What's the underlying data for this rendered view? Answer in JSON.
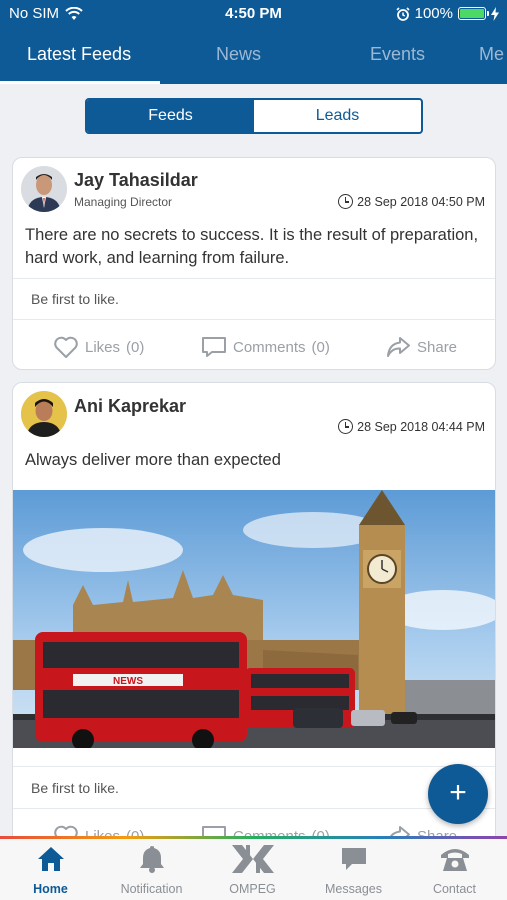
{
  "status_bar": {
    "carrier": "No SIM",
    "time": "4:50 PM",
    "battery": "100%",
    "battery_level": 1.0
  },
  "tabs": [
    {
      "label": "Latest Feeds",
      "active": true
    },
    {
      "label": "News",
      "active": false
    },
    {
      "label": "Events",
      "active": false
    },
    {
      "label": "Me",
      "active": false
    }
  ],
  "segments": [
    {
      "label": "Feeds",
      "active": true
    },
    {
      "label": "Leads",
      "active": false
    }
  ],
  "posts": [
    {
      "author": "Jay Tahasildar",
      "role": "Managing Director",
      "timestamp": "28 Sep 2018 04:50 PM",
      "text": "There are no secrets to success. It is the result of preparation, hard work, and learning from failure.",
      "like_note": "Be first to like.",
      "likes_label": "Likes",
      "likes_count": "(0)",
      "comments_label": "Comments",
      "comments_count": "(0)",
      "share_label": "Share"
    },
    {
      "author": "Ani Kaprekar",
      "timestamp": "28 Sep 2018 04:44 PM",
      "text": "Always deliver more than expected",
      "like_note": "Be first to like.",
      "likes_label": "Likes",
      "likes_count": "(0)",
      "comments_label": "Comments",
      "comments_count": "(0)",
      "share_label": "Share",
      "image": "london-big-ben-red-bus-photo",
      "image_bus_text": "NEWS"
    }
  ],
  "fab": {
    "icon": "plus-icon",
    "label": "+"
  },
  "bottom_nav": [
    {
      "label": "Home",
      "icon": "home-icon",
      "active": true
    },
    {
      "label": "Notification",
      "icon": "bell-icon",
      "active": false
    },
    {
      "label": "OMPEG",
      "icon": "ompeg-logo-icon",
      "active": false
    },
    {
      "label": "Messages",
      "icon": "chat-bubble-icon",
      "active": false
    },
    {
      "label": "Contact",
      "icon": "phone-icon",
      "active": false
    }
  ],
  "colors": {
    "primary": "#0e5a96",
    "tab_inactive": "#9cb8d3",
    "action_gray": "#9aa0a6",
    "background": "#eef0f3"
  }
}
